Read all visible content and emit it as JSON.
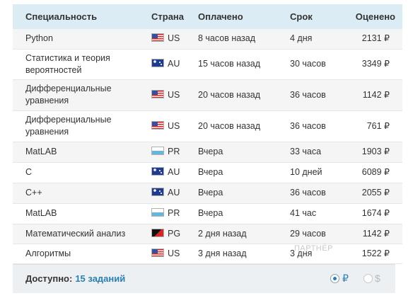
{
  "headers": {
    "specialty": "Специальность",
    "country": "Страна",
    "paid": "Оплачено",
    "term": "Срок",
    "price": "Оценено"
  },
  "rows": [
    {
      "spec": "Python",
      "flag": "flag-us-icon",
      "country": "US",
      "paid": "8 часов назад",
      "term": "4 дня",
      "price": "2131 ₽"
    },
    {
      "spec": "Статистика и теория вероятностей",
      "flag": "flag-au-icon",
      "country": "AU",
      "paid": "15 часов назад",
      "term": "30 часов",
      "price": "3349 ₽"
    },
    {
      "spec": "Дифференциальные уравнения",
      "flag": "flag-us-icon",
      "country": "US",
      "paid": "20 часов назад",
      "term": "36 часов",
      "price": "1142 ₽"
    },
    {
      "spec": "Дифференциальные уравнения",
      "flag": "flag-us-icon",
      "country": "US",
      "paid": "20 часов назад",
      "term": "36 часов",
      "price": "761 ₽"
    },
    {
      "spec": "MatLAB",
      "flag": "flag-pr-icon",
      "country": "PR",
      "paid": "Вчера",
      "term": "33 часа",
      "price": "1903 ₽"
    },
    {
      "spec": "C",
      "flag": "flag-au-icon",
      "country": "AU",
      "paid": "Вчера",
      "term": "10 дней",
      "price": "6089 ₽"
    },
    {
      "spec": "C++",
      "flag": "flag-au-icon",
      "country": "AU",
      "paid": "Вчера",
      "term": "36 часов",
      "price": "2055 ₽"
    },
    {
      "spec": "MatLAB",
      "flag": "flag-pr-icon",
      "country": "PR",
      "paid": "Вчера",
      "term": "41 час",
      "price": "1674 ₽"
    },
    {
      "spec": "Математический анализ",
      "flag": "flag-pg-icon",
      "country": "PG",
      "paid": "2 дня назад",
      "term": "29 часов",
      "price": "1142 ₽"
    },
    {
      "spec": "Алгоритмы",
      "flag": "flag-us-icon",
      "country": "US",
      "paid": "3 дня назад",
      "term": "3 дня",
      "price": "1522 ₽"
    }
  ],
  "footer": {
    "label": "Доступно:",
    "count": "15 заданий",
    "currency_rub": "₽",
    "currency_usd": "$",
    "selected_currency": "₽"
  },
  "watermark": "ПАРТНЁР"
}
